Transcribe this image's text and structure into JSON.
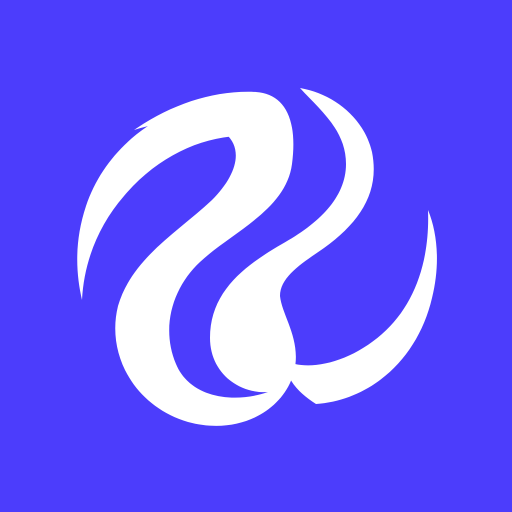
{
  "icon": {
    "name": "swirl-logo-icon",
    "background_color": "#4c3dfc",
    "foreground_color": "#ffffff"
  }
}
